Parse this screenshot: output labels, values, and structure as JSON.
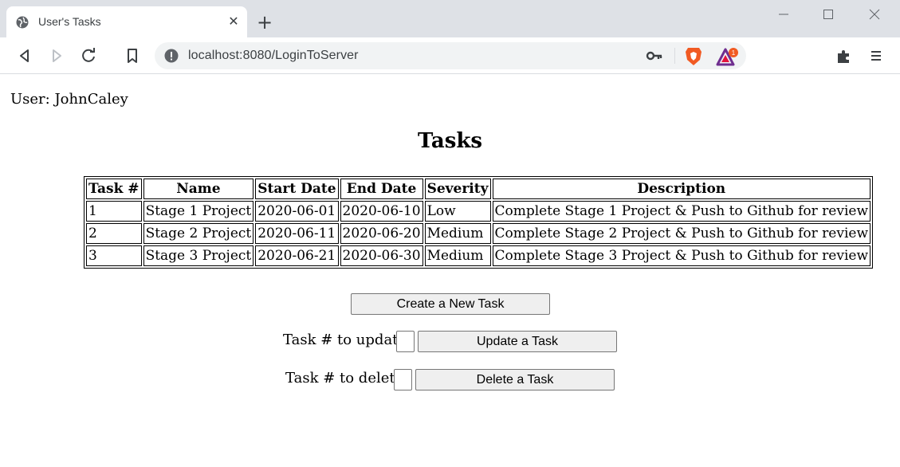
{
  "browser": {
    "tab_title": "User's Tasks",
    "url": "localhost:8080/LoginToServer",
    "rewards_badge": "1",
    "accent": "#f15a22"
  },
  "page": {
    "user_line": "User: JohnCaley",
    "title": "Tasks",
    "table": {
      "headers": [
        "Task #",
        "Name",
        "Start Date",
        "End Date",
        "Severity",
        "Description"
      ],
      "rows": [
        [
          "1",
          "Stage 1 Project",
          "2020-06-01",
          "2020-06-10",
          "Low",
          "Complete Stage 1 Project & Push to Github for review"
        ],
        [
          "2",
          "Stage 2 Project",
          "2020-06-11",
          "2020-06-20",
          "Medium",
          "Complete Stage 2 Project & Push to Github for review"
        ],
        [
          "3",
          "Stage 3 Project",
          "2020-06-21",
          "2020-06-30",
          "Medium",
          "Complete Stage 3 Project & Push to Github for review"
        ]
      ]
    },
    "create_button": "Create a New Task",
    "update_label": "Task # to update:",
    "update_input_value": "",
    "update_button": "Update a Task",
    "delete_label": "Task # to delete:",
    "delete_input_value": "",
    "delete_button": "Delete a Task"
  }
}
